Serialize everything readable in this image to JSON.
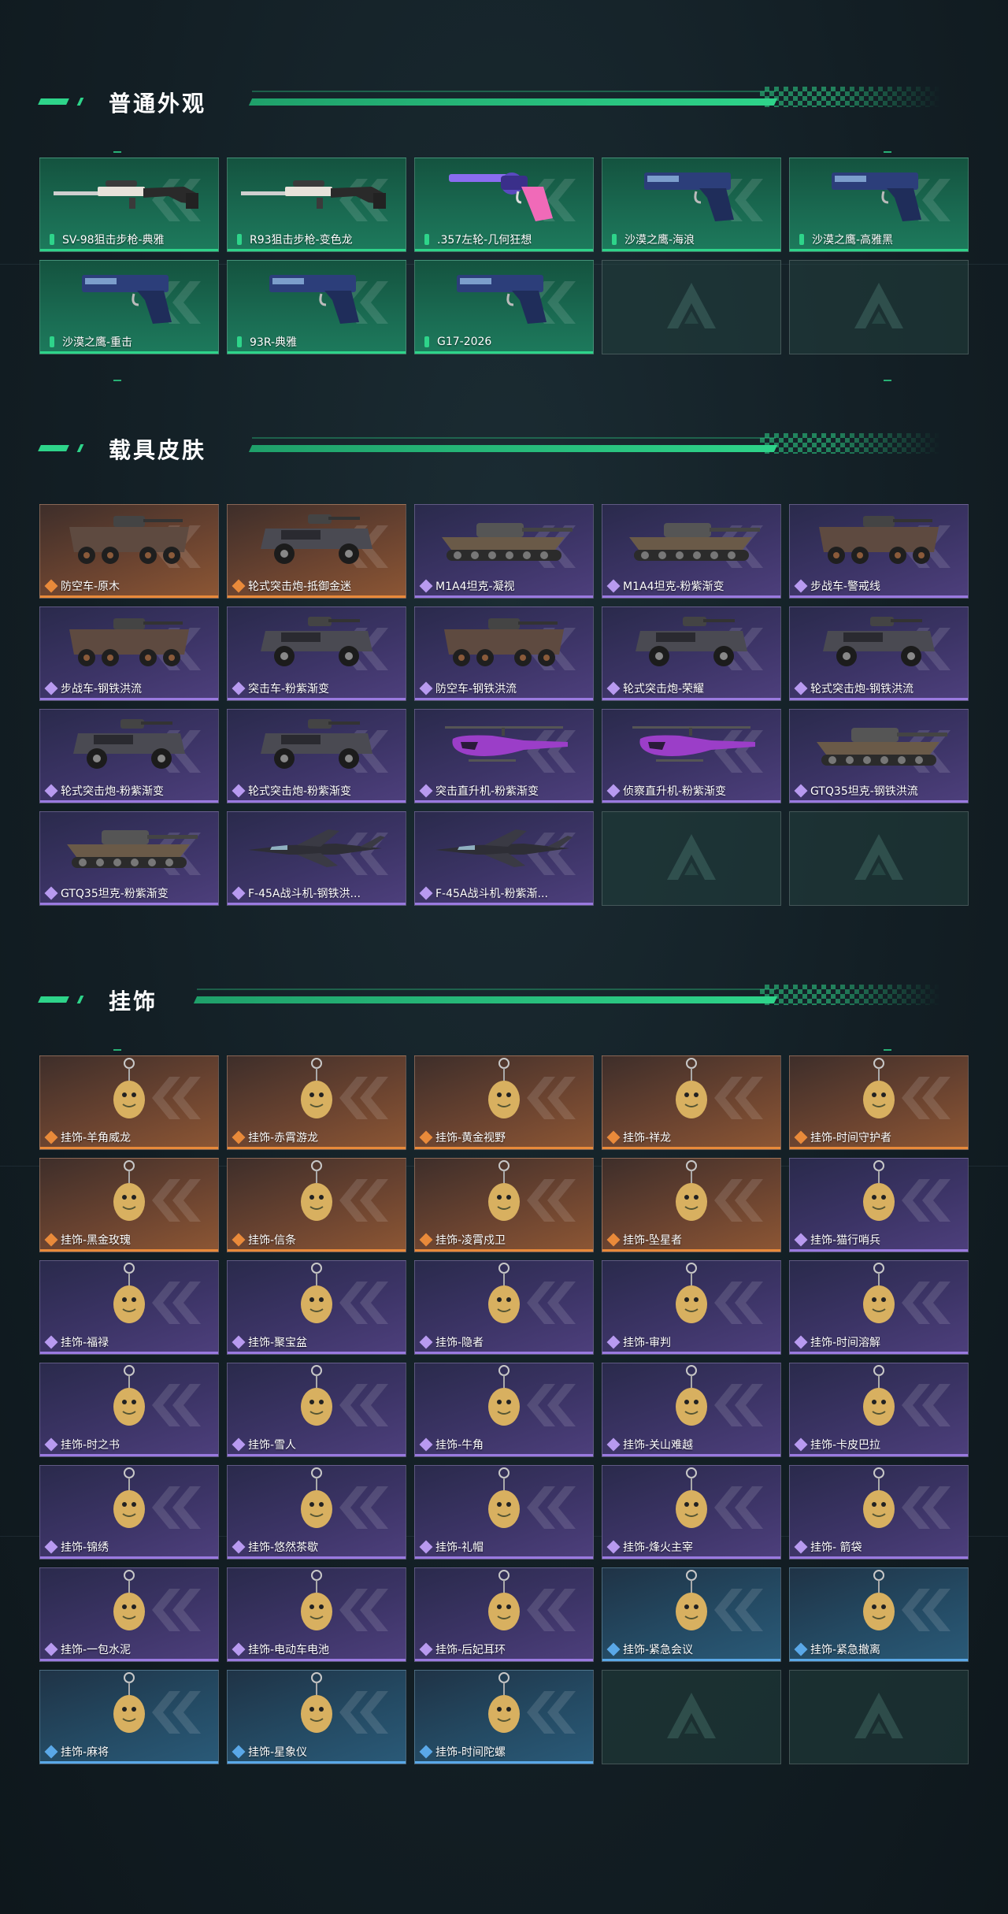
{
  "sections": [
    {
      "title": "普通外观",
      "items": [
        {
          "label": "SV-98狙击步枪-典雅",
          "rarity": "green",
          "icon": "sniper-rifle-icon"
        },
        {
          "label": "R93狙击步枪-变色龙",
          "rarity": "green",
          "icon": "sniper-rifle-icon"
        },
        {
          "label": ".357左轮-几何狂想",
          "rarity": "green",
          "icon": "revolver-icon"
        },
        {
          "label": "沙漠之鹰-海浪",
          "rarity": "green",
          "icon": "pistol-icon"
        },
        {
          "label": "沙漠之鹰-高雅黑",
          "rarity": "green",
          "icon": "pistol-icon"
        },
        {
          "label": "沙漠之鹰-重击",
          "rarity": "green",
          "icon": "pistol-icon"
        },
        {
          "label": "93R-典雅",
          "rarity": "green",
          "icon": "pistol-icon"
        },
        {
          "label": "G17-2026",
          "rarity": "green",
          "icon": "pistol-icon"
        },
        {
          "label": "",
          "rarity": "empty",
          "icon": "placeholder-logo-icon"
        },
        {
          "label": "",
          "rarity": "empty",
          "icon": "placeholder-logo-icon"
        }
      ]
    },
    {
      "title": "载具皮肤",
      "items": [
        {
          "label": "防空车-原木",
          "rarity": "orange",
          "icon": "armored-vehicle-icon"
        },
        {
          "label": "轮式突击炮-抵御金迷",
          "rarity": "orange",
          "icon": "assault-vehicle-icon"
        },
        {
          "label": "M1A4坦克-凝视",
          "rarity": "purple",
          "icon": "tank-icon"
        },
        {
          "label": "M1A4坦克-粉紫渐变",
          "rarity": "purple",
          "icon": "tank-icon"
        },
        {
          "label": "步战车-警戒线",
          "rarity": "purple",
          "icon": "armored-vehicle-icon"
        },
        {
          "label": "步战车-钢铁洪流",
          "rarity": "purple",
          "icon": "armored-vehicle-icon"
        },
        {
          "label": "突击车-粉紫渐变",
          "rarity": "purple",
          "icon": "assault-vehicle-icon"
        },
        {
          "label": "防空车-钢铁洪流",
          "rarity": "purple",
          "icon": "armored-vehicle-icon"
        },
        {
          "label": "轮式突击炮-荣耀",
          "rarity": "purple",
          "icon": "assault-vehicle-icon"
        },
        {
          "label": "轮式突击炮-钢铁洪流",
          "rarity": "purple",
          "icon": "assault-vehicle-icon"
        },
        {
          "label": "轮式突击炮-粉紫渐变",
          "rarity": "purple",
          "icon": "assault-vehicle-icon"
        },
        {
          "label": "轮式突击炮-粉紫渐变",
          "rarity": "purple",
          "icon": "assault-vehicle-icon"
        },
        {
          "label": "突击直升机-粉紫渐变",
          "rarity": "purple",
          "icon": "helicopter-icon"
        },
        {
          "label": "侦察直升机-粉紫渐变",
          "rarity": "purple",
          "icon": "helicopter-icon"
        },
        {
          "label": "GTQ35坦克-钢铁洪流",
          "rarity": "purple",
          "icon": "tank-icon"
        },
        {
          "label": "GTQ35坦克-粉紫渐变",
          "rarity": "purple",
          "icon": "tank-icon"
        },
        {
          "label": "F-45A战斗机-钢铁洪...",
          "rarity": "purple",
          "icon": "fighter-jet-icon"
        },
        {
          "label": "F-45A战斗机-粉紫渐...",
          "rarity": "purple",
          "icon": "fighter-jet-icon"
        },
        {
          "label": "",
          "rarity": "empty",
          "icon": "placeholder-logo-icon"
        },
        {
          "label": "",
          "rarity": "empty",
          "icon": "placeholder-logo-icon"
        }
      ]
    },
    {
      "title": "挂饰",
      "items": [
        {
          "label": "挂饰-羊角威龙",
          "rarity": "orange",
          "icon": "charm-icon"
        },
        {
          "label": "挂饰-赤霄游龙",
          "rarity": "orange",
          "icon": "charm-icon"
        },
        {
          "label": "挂饰-黄金视野",
          "rarity": "orange",
          "icon": "charm-icon"
        },
        {
          "label": "挂饰-祥龙",
          "rarity": "orange",
          "icon": "charm-icon"
        },
        {
          "label": "挂饰-时间守护者",
          "rarity": "orange",
          "icon": "charm-icon"
        },
        {
          "label": "挂饰-黑金玫瑰",
          "rarity": "orange",
          "icon": "charm-icon"
        },
        {
          "label": "挂饰-信条",
          "rarity": "orange",
          "icon": "charm-icon"
        },
        {
          "label": "挂饰-凌霄戍卫",
          "rarity": "orange",
          "icon": "charm-icon"
        },
        {
          "label": "挂饰-坠星者",
          "rarity": "orange",
          "icon": "charm-icon"
        },
        {
          "label": "挂饰-猫行哨兵",
          "rarity": "purple",
          "icon": "charm-icon"
        },
        {
          "label": "挂饰-福禄",
          "rarity": "purple",
          "icon": "charm-icon"
        },
        {
          "label": "挂饰-聚宝盆",
          "rarity": "purple",
          "icon": "charm-icon"
        },
        {
          "label": "挂饰-隐者",
          "rarity": "purple",
          "icon": "charm-icon"
        },
        {
          "label": "挂饰-审判",
          "rarity": "purple",
          "icon": "charm-icon"
        },
        {
          "label": "挂饰-时间溶解",
          "rarity": "purple",
          "icon": "charm-icon"
        },
        {
          "label": "挂饰-时之书",
          "rarity": "purple",
          "icon": "charm-icon"
        },
        {
          "label": "挂饰-雪人",
          "rarity": "purple",
          "icon": "charm-icon"
        },
        {
          "label": "挂饰-牛角",
          "rarity": "purple",
          "icon": "charm-icon"
        },
        {
          "label": "挂饰-关山难越",
          "rarity": "purple",
          "icon": "charm-icon"
        },
        {
          "label": "挂饰-卡皮巴拉",
          "rarity": "purple",
          "icon": "charm-icon"
        },
        {
          "label": "挂饰-锦绣",
          "rarity": "purple",
          "icon": "charm-icon"
        },
        {
          "label": "挂饰-悠然茶歇",
          "rarity": "purple",
          "icon": "charm-icon"
        },
        {
          "label": "挂饰-礼帽",
          "rarity": "purple",
          "icon": "charm-icon"
        },
        {
          "label": "挂饰-烽火主宰",
          "rarity": "purple",
          "icon": "charm-icon"
        },
        {
          "label": "挂饰- 箭袋",
          "rarity": "purple",
          "icon": "charm-icon"
        },
        {
          "label": "挂饰-一包水泥",
          "rarity": "purple",
          "icon": "charm-icon"
        },
        {
          "label": "挂饰-电动车电池",
          "rarity": "purple",
          "icon": "charm-icon"
        },
        {
          "label": "挂饰-后妃耳环",
          "rarity": "purple",
          "icon": "charm-icon"
        },
        {
          "label": "挂饰-紧急会议",
          "rarity": "blue",
          "icon": "charm-icon"
        },
        {
          "label": "挂饰-紧急撤离",
          "rarity": "blue",
          "icon": "charm-icon"
        },
        {
          "label": "挂饰-麻将",
          "rarity": "blue",
          "icon": "charm-icon"
        },
        {
          "label": "挂饰-星象仪",
          "rarity": "blue",
          "icon": "charm-icon"
        },
        {
          "label": "挂饰-时间陀螺",
          "rarity": "blue",
          "icon": "charm-icon"
        },
        {
          "label": "",
          "rarity": "empty",
          "icon": "placeholder-logo-icon"
        },
        {
          "label": "",
          "rarity": "empty",
          "icon": "placeholder-logo-icon"
        }
      ]
    }
  ],
  "colors": {
    "accent": "#2ed48a",
    "green": "#1a6b52",
    "orange": "#e98a3a",
    "purple": "#9a7ae0",
    "blue": "#5aa8e8"
  }
}
